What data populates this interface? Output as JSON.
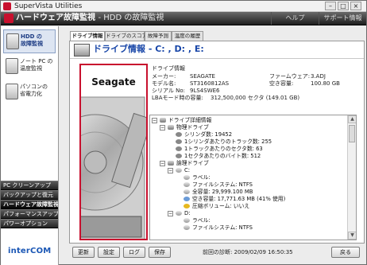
{
  "window": {
    "title": "SuperVista Utilities",
    "controls": {
      "minimize": "–",
      "maximize": "□",
      "close": "×"
    }
  },
  "header": {
    "title": "ハードウェア故障監視",
    "subtitle": "- HDD の故障監視",
    "nav": [
      {
        "label": "ヘルプ"
      },
      {
        "label": "サポート情報"
      }
    ]
  },
  "sidebar": {
    "items": [
      {
        "label": "HDD の\n故障監視",
        "icon": "hdd-icon"
      },
      {
        "label": "ノート PC の\n温度監視",
        "icon": "notebook-icon"
      },
      {
        "label": "パソコンの\n省電力化",
        "icon": "monitor-icon"
      }
    ],
    "categories": [
      {
        "label": "PC クリーンアップ"
      },
      {
        "label": "バックアップと復元"
      },
      {
        "label": "ハードウェア故障監視"
      },
      {
        "label": "パフォーマンスアップ"
      },
      {
        "label": "パワーオプション"
      }
    ],
    "active_category": 2,
    "logo": "interCOM"
  },
  "tabs": [
    {
      "label": "ドライブ情報"
    },
    {
      "label": "ドライブのスコア"
    },
    {
      "label": "故障予測"
    },
    {
      "label": "温度の履歴"
    }
  ],
  "panel": {
    "title": "ドライブ情報 - C: , D: , E:",
    "brand": "Seagate",
    "info": {
      "section": "ドライブ情報",
      "maker_label": "メーカー:",
      "maker": "SEAGATE",
      "model_label": "モデル名:",
      "model": "ST3160812AS",
      "serial_label": "シリアル No:",
      "serial": "9LS4SWE6",
      "lba_label": "LBAモード時の容量:",
      "lba": "312,500,000 セクタ (149.01 GB)",
      "fw_label": "ファームウェア:",
      "fw": "3.ADJ",
      "free_label": "空き容量:",
      "free": "100.80 GB"
    }
  },
  "tree": {
    "items": [
      {
        "label": "ドライブ詳細情報",
        "level": 0,
        "icon": "hdd-icon",
        "expander": "−"
      },
      {
        "label": "物理ドライブ",
        "level": 1,
        "icon": "hdd-icon",
        "expander": "−"
      },
      {
        "label": "シリンダ数: 19452",
        "level": 2,
        "icon": "gear-icon"
      },
      {
        "label": "1シリンダあたりのトラック数: 255",
        "level": 2,
        "icon": "gear-icon"
      },
      {
        "label": "1トラックあたりのセクタ数: 63",
        "level": 2,
        "icon": "gear-icon"
      },
      {
        "label": "1セクタあたりのバイト数: 512",
        "level": 2,
        "icon": "gear-icon"
      },
      {
        "label": "論理ドライブ",
        "level": 1,
        "icon": "hdd-icon",
        "expander": "−"
      },
      {
        "label": "C:",
        "level": 2,
        "icon": "partition-icon",
        "expander": "−"
      },
      {
        "label": "ラベル:",
        "level": 3,
        "icon": "partition-icon"
      },
      {
        "label": "ファイルシステム: NTFS",
        "level": 3,
        "icon": "partition-icon"
      },
      {
        "label": "全容量: 29,999.100 MB",
        "level": 3,
        "icon": "partition-icon"
      },
      {
        "label": "空き容量: 17,771.63 MB (41% 使用)",
        "level": 3,
        "icon": "info-icon"
      },
      {
        "label": "圧縮ボリューム: いいえ",
        "level": 3,
        "icon": "warning-icon"
      },
      {
        "label": "D:",
        "level": 2,
        "icon": "partition-icon",
        "expander": "−"
      },
      {
        "label": "ラベル:",
        "level": 3,
        "icon": "partition-icon"
      },
      {
        "label": "ファイルシステム: NTFS",
        "level": 3,
        "icon": "partition-icon"
      }
    ]
  },
  "footer": {
    "buttons": [
      {
        "label": "更新"
      },
      {
        "label": "設定"
      },
      {
        "label": "ログ"
      },
      {
        "label": "保存"
      }
    ],
    "diag_label": "前回の診断:",
    "diag_time": "2009/02/09 16:50:35",
    "back": "戻る"
  }
}
